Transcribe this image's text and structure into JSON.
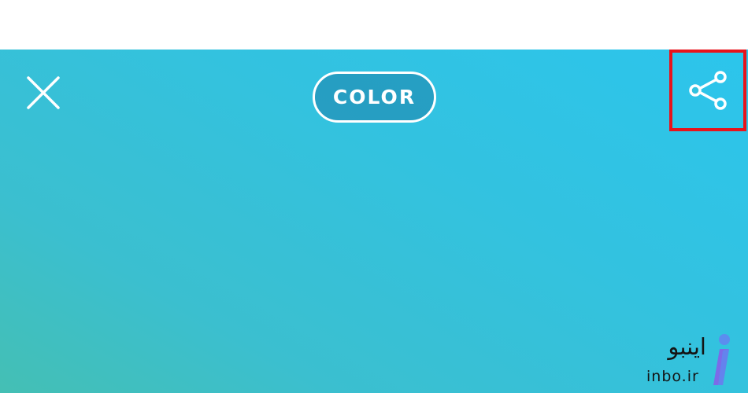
{
  "toolbar": {
    "close_icon": "close-icon",
    "mode_label": "COLOR",
    "share_icon": "share-icon",
    "highlight_color": "#e8131b"
  },
  "canvas": {
    "gradient_colors": [
      "#2cc5ec",
      "#44bfb4"
    ]
  },
  "watermark": {
    "brand_fa": "اینبو",
    "brand_url": "inbo.ir",
    "logo_icon": "inbo-logo-icon",
    "logo_colors": [
      "#5b8def",
      "#7b6be8"
    ]
  }
}
